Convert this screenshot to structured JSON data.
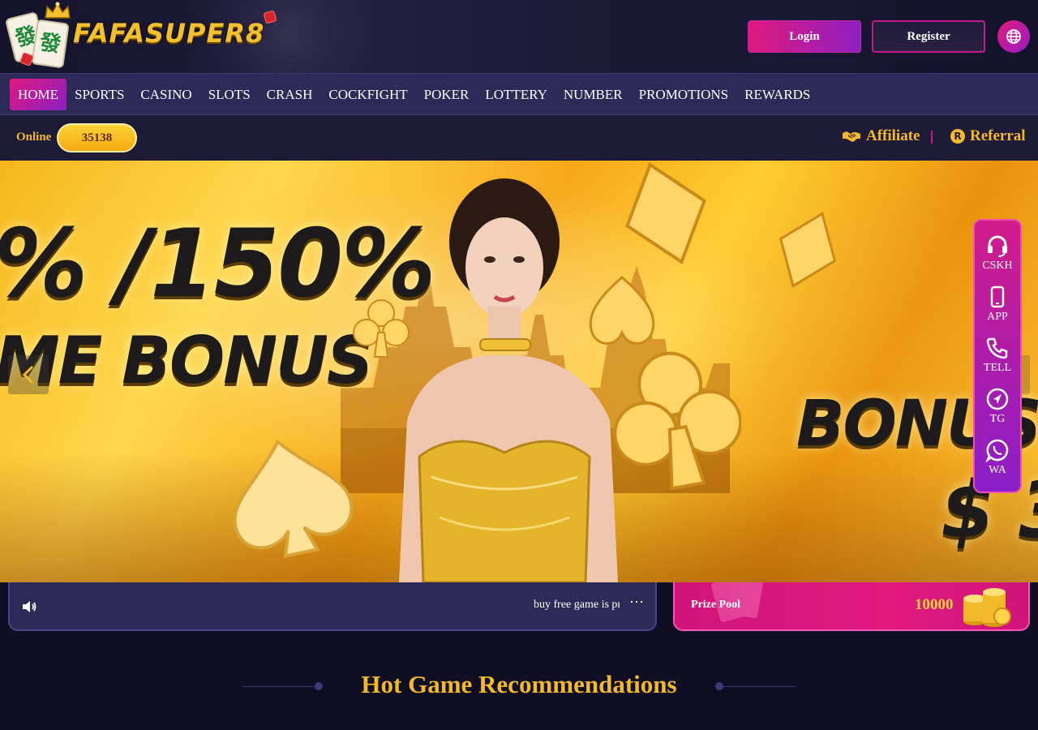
{
  "brand": {
    "name": "FAFASUPER8",
    "tile_glyph": "發"
  },
  "header": {
    "login_label": "Login",
    "register_label": "Register",
    "language_icon": "globe-icon"
  },
  "nav": {
    "items": [
      {
        "label": "HOME",
        "active": true
      },
      {
        "label": "SPORTS",
        "active": false
      },
      {
        "label": "CASINO",
        "active": false
      },
      {
        "label": "SLOTS",
        "active": false
      },
      {
        "label": "CRASH",
        "active": false
      },
      {
        "label": "COCKFIGHT",
        "active": false
      },
      {
        "label": "POKER",
        "active": false
      },
      {
        "label": "LOTTERY",
        "active": false
      },
      {
        "label": "NUMBER",
        "active": false
      },
      {
        "label": "PROMOTIONS",
        "active": false
      },
      {
        "label": "REWARDS",
        "active": false
      }
    ]
  },
  "info": {
    "online_label": "Online",
    "online_count": "35138",
    "affiliate_label": "Affiliate",
    "referral_label": "Referral",
    "referral_icon_glyph": "R"
  },
  "banner": {
    "headline_top": "% /150%",
    "headline_bottom": "ME BONUS",
    "right_headline": "BONUS",
    "right_amount": "$ 3",
    "prev_icon": "chevron-left-icon",
    "next_icon": "chevron-right-icon"
  },
  "dock": {
    "items": [
      {
        "label": "CSKH",
        "icon": "headset-icon"
      },
      {
        "label": "APP",
        "icon": "phone-device-icon"
      },
      {
        "label": "TELL",
        "icon": "phone-call-icon"
      },
      {
        "label": "TG",
        "icon": "telegram-icon"
      },
      {
        "label": "WA",
        "icon": "whatsapp-icon"
      }
    ]
  },
  "marquee": {
    "text": "buy free game is pr",
    "more_label": "⋯"
  },
  "prize_pool": {
    "label": "Prize Pool",
    "value": "10000"
  },
  "section": {
    "title": "Hot Game Recommendations"
  },
  "colors": {
    "accent_pink": "#e0197e",
    "accent_purple": "#8d1fc2",
    "gold": "#f3b82b",
    "nav_bg": "#2d2a57",
    "page_bg": "#100e22"
  }
}
